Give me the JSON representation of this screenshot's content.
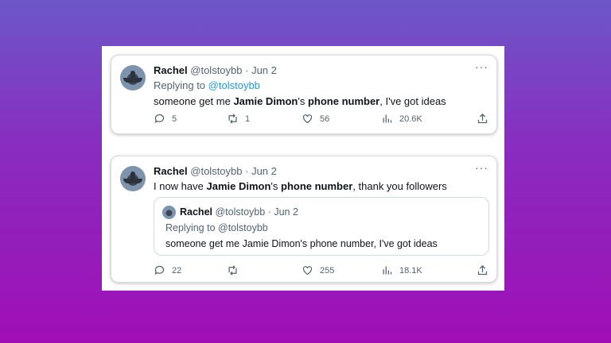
{
  "tweet1": {
    "name": "Rachel",
    "handle": "@tolstoybb",
    "date": "· Jun 2",
    "reply_prefix": "Replying to",
    "reply_to": "@tolstoybb",
    "text_a": "someone get me ",
    "text_b": "Jamie Dimon",
    "text_c": "'s ",
    "text_d": "phone number",
    "text_e": ", I've got ideas",
    "replies": "5",
    "retweets": "1",
    "likes": "56",
    "views": "20.6K",
    "more": "···"
  },
  "tweet2": {
    "name": "Rachel",
    "handle": "@tolstoybb",
    "date": "· Jun 2",
    "text_a": "I now have ",
    "text_b": "Jamie Dimon",
    "text_c": "'s ",
    "text_d": "phone number",
    "text_e": ", thank you followers",
    "replies": "22",
    "retweets": "",
    "likes": "255",
    "views": "18.1K",
    "more": "···",
    "quote": {
      "name": "Rachel",
      "handle": "@tolstoybb",
      "date": "· Jun 2",
      "reply_line": "Replying to @tolstoybb",
      "text": "someone get me Jamie Dimon's phone number, I've got ideas"
    }
  },
  "colors": {
    "accent": "#1d9bf0",
    "text": "#0f1419",
    "muted": "#536471"
  },
  "icons": [
    "reply-icon",
    "retweet-icon",
    "like-icon",
    "views-icon",
    "share-icon",
    "more-icon"
  ]
}
